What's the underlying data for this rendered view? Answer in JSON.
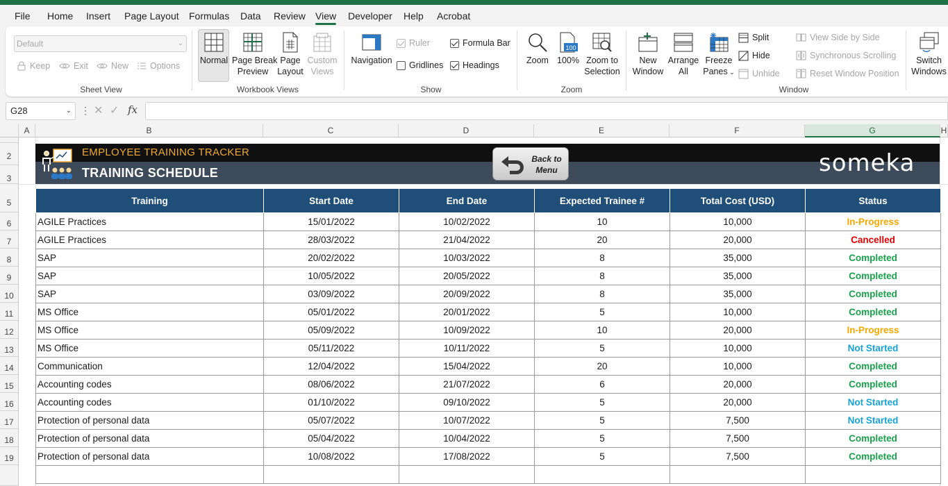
{
  "menu": {
    "tabs": [
      "File",
      "Home",
      "Insert",
      "Page Layout",
      "Formulas",
      "Data",
      "Review",
      "View",
      "Developer",
      "Help",
      "Acrobat"
    ],
    "active": "View"
  },
  "ribbon": {
    "sheet_view": {
      "label": "Sheet View",
      "select_value": "Default",
      "keep": "Keep",
      "exit": "Exit",
      "new": "New",
      "options": "Options"
    },
    "workbook_views": {
      "label": "Workbook Views",
      "normal": "Normal",
      "page_break_1": "Page Break",
      "page_break_2": "Preview",
      "page_layout_1": "Page",
      "page_layout_2": "Layout",
      "custom_1": "Custom",
      "custom_2": "Views"
    },
    "show": {
      "label": "Show",
      "navigation": "Navigation",
      "ruler": "Ruler",
      "gridlines": "Gridlines",
      "formula_bar": "Formula Bar",
      "headings": "Headings"
    },
    "zoom": {
      "label": "Zoom",
      "zoom": "Zoom",
      "hundred": "100%",
      "zoom_sel_1": "Zoom to",
      "zoom_sel_2": "Selection",
      "icon_text": "100"
    },
    "window": {
      "label": "Window",
      "new_window_1": "New",
      "new_window_2": "Window",
      "arrange_1": "Arrange",
      "arrange_2": "All",
      "freeze_1": "Freeze",
      "freeze_2": "Panes",
      "split": "Split",
      "hide": "Hide",
      "unhide": "Unhide",
      "side_by_side": "View Side by Side",
      "sync_scroll": "Synchronous Scrolling",
      "reset_pos": "Reset Window Position",
      "switch_1": "Switch",
      "switch_2": "Windows"
    }
  },
  "formula_bar": {
    "name_box": "G28",
    "fx": "fx",
    "value": ""
  },
  "grid": {
    "columns": [
      "A",
      "B",
      "C",
      "D",
      "E",
      "F",
      "G",
      "H"
    ],
    "selected_column": "G",
    "rows": [
      "2",
      "3",
      "5",
      "6",
      "7",
      "8",
      "9",
      "10",
      "11",
      "12",
      "13",
      "14",
      "15",
      "16",
      "17",
      "18",
      "19"
    ]
  },
  "banner": {
    "subtitle": "EMPLOYEE TRAINING TRACKER",
    "title": "TRAINING SCHEDULE",
    "back_line1": "Back to",
    "back_line2": "Menu",
    "brand": "someka"
  },
  "table": {
    "headers": [
      "Training",
      "Start Date",
      "End Date",
      "Expected  Trainee #",
      "Total Cost (USD)",
      "Status"
    ],
    "rows": [
      [
        "AGILE Practices",
        "15/01/2022",
        "10/02/2022",
        "10",
        "10,000",
        "In-Progress"
      ],
      [
        "AGILE Practices",
        "28/03/2022",
        "21/04/2022",
        "20",
        "20,000",
        "Cancelled"
      ],
      [
        "SAP",
        "20/02/2022",
        "10/03/2022",
        "8",
        "35,000",
        "Completed"
      ],
      [
        "SAP",
        "10/05/2022",
        "20/05/2022",
        "8",
        "35,000",
        "Completed"
      ],
      [
        "SAP",
        "03/09/2022",
        "20/09/2022",
        "8",
        "35,000",
        "Completed"
      ],
      [
        "MS Office",
        "05/01/2022",
        "20/01/2022",
        "5",
        "10,000",
        "Completed"
      ],
      [
        "MS Office",
        "05/09/2022",
        "10/09/2022",
        "10",
        "20,000",
        "In-Progress"
      ],
      [
        "MS Office",
        "05/11/2022",
        "10/11/2022",
        "5",
        "10,000",
        "Not Started"
      ],
      [
        "Communication",
        "12/04/2022",
        "15/04/2022",
        "20",
        "10,000",
        "Completed"
      ],
      [
        "Accounting codes",
        "08/06/2022",
        "21/07/2022",
        "6",
        "20,000",
        "Completed"
      ],
      [
        "Accounting codes",
        "01/10/2022",
        "09/10/2022",
        "5",
        "20,000",
        "Not Started"
      ],
      [
        "Protection of personal data",
        "05/07/2022",
        "10/07/2022",
        "5",
        "7,500",
        "Not Started"
      ],
      [
        "Protection of personal data",
        "05/04/2022",
        "10/04/2022",
        "5",
        "7,500",
        "Completed"
      ],
      [
        "Protection of personal data",
        "10/08/2022",
        "17/08/2022",
        "5",
        "7,500",
        "Completed"
      ],
      [
        "",
        "",
        "",
        "",
        "",
        ""
      ]
    ],
    "status_colors": {
      "In-Progress": "#f5a800",
      "Cancelled": "#e00000",
      "Completed": "#17a34a",
      "Not Started": "#18a3d6"
    }
  },
  "colors": {
    "excel_green": "#1e7145",
    "header_navy": "#1f4e79",
    "banner_orange": "#f0a92e"
  }
}
